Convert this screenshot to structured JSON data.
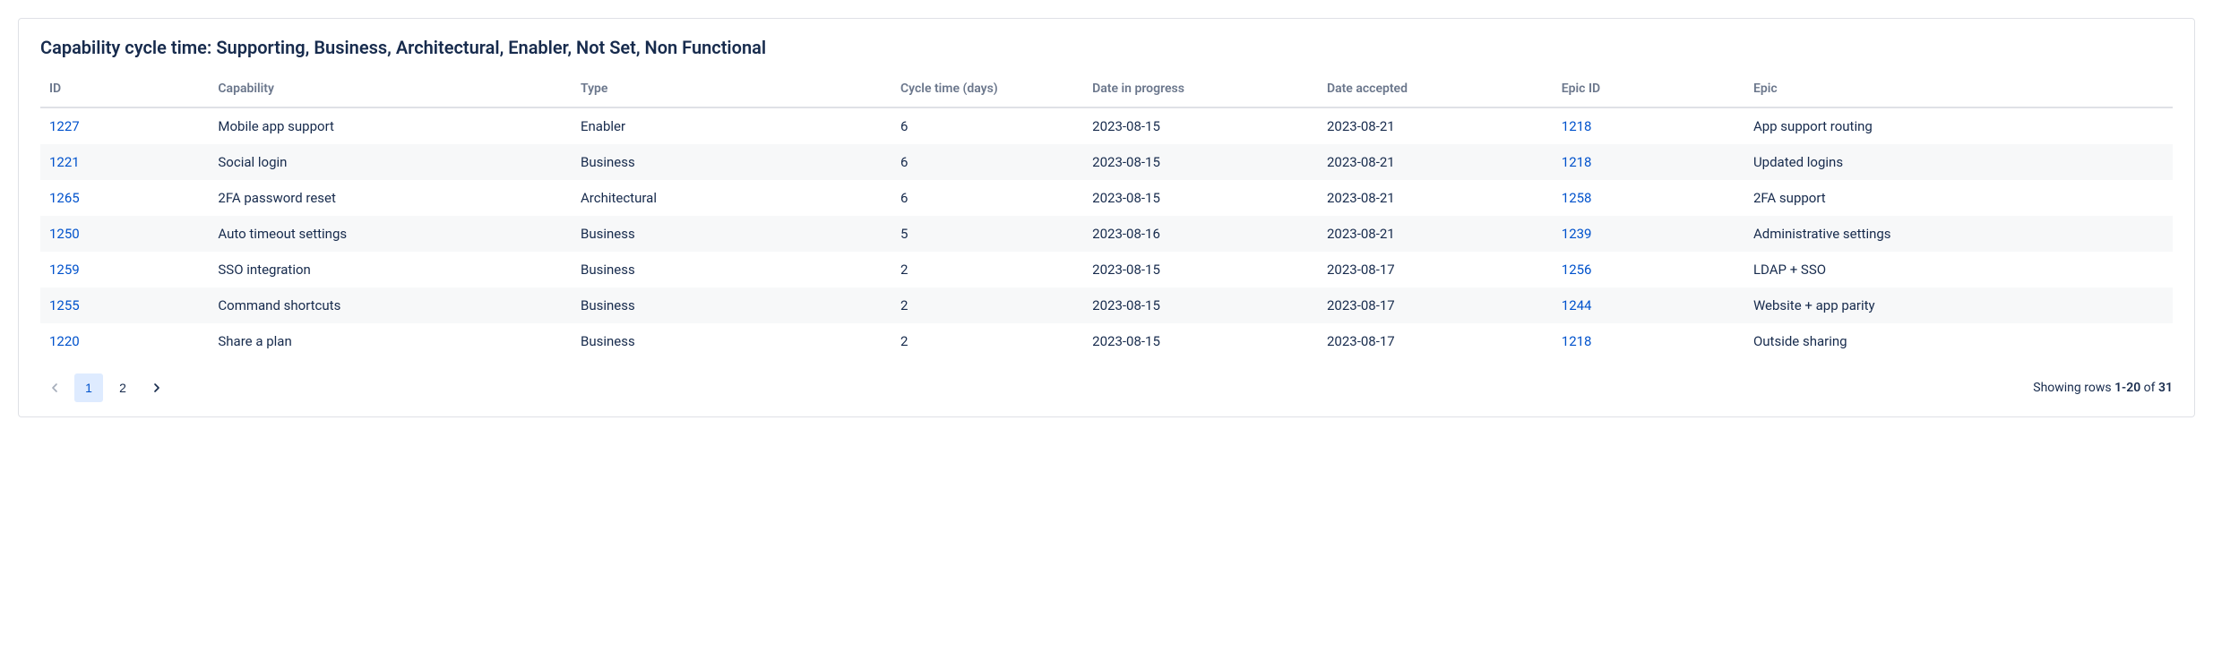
{
  "title": "Capability cycle time: Supporting, Business, Architectural, Enabler, Not Set, Non Functional",
  "columns": {
    "id": "ID",
    "capability": "Capability",
    "type": "Type",
    "cycle_time": "Cycle time (days)",
    "date_in_progress": "Date in progress",
    "date_accepted": "Date accepted",
    "epic_id": "Epic ID",
    "epic": "Epic"
  },
  "rows": [
    {
      "id": "1227",
      "capability": "Mobile app support",
      "type": "Enabler",
      "cycle_time": "6",
      "date_in_progress": "2023-08-15",
      "date_accepted": "2023-08-21",
      "epic_id": "1218",
      "epic": "App support routing"
    },
    {
      "id": "1221",
      "capability": "Social login",
      "type": "Business",
      "cycle_time": "6",
      "date_in_progress": "2023-08-15",
      "date_accepted": "2023-08-21",
      "epic_id": "1218",
      "epic": "Updated logins"
    },
    {
      "id": "1265",
      "capability": "2FA password reset",
      "type": "Architectural",
      "cycle_time": "6",
      "date_in_progress": "2023-08-15",
      "date_accepted": "2023-08-21",
      "epic_id": "1258",
      "epic": "2FA support"
    },
    {
      "id": "1250",
      "capability": "Auto timeout settings",
      "type": "Business",
      "cycle_time": "5",
      "date_in_progress": "2023-08-16",
      "date_accepted": "2023-08-21",
      "epic_id": "1239",
      "epic": "Administrative settings"
    },
    {
      "id": "1259",
      "capability": "SSO integration",
      "type": "Business",
      "cycle_time": "2",
      "date_in_progress": "2023-08-15",
      "date_accepted": "2023-08-17",
      "epic_id": "1256",
      "epic": "LDAP + SSO"
    },
    {
      "id": "1255",
      "capability": "Command shortcuts",
      "type": "Business",
      "cycle_time": "2",
      "date_in_progress": "2023-08-15",
      "date_accepted": "2023-08-17",
      "epic_id": "1244",
      "epic": "Website + app parity"
    },
    {
      "id": "1220",
      "capability": "Share a plan",
      "type": "Business",
      "cycle_time": "2",
      "date_in_progress": "2023-08-15",
      "date_accepted": "2023-08-17",
      "epic_id": "1218",
      "epic": "Outside sharing"
    }
  ],
  "pagination": {
    "pages": [
      "1",
      "2"
    ],
    "current": "1",
    "rows_label_prefix": "Showing rows ",
    "rows_range": "1-20",
    "rows_of": " of ",
    "rows_total": "31"
  }
}
